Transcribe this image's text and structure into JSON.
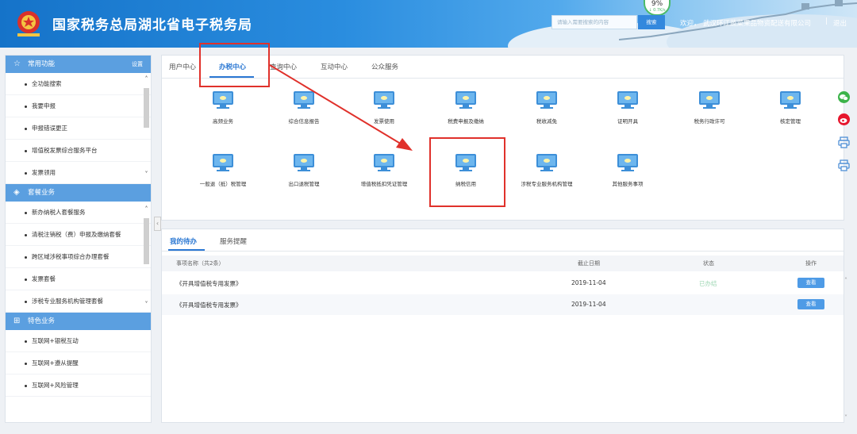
{
  "header": {
    "title": "国家税务总局湖北省电子税务局",
    "search_placeholder": "请输入需要搜索的内容",
    "search_button": "搜索",
    "speed_value": "9%",
    "speed_sub": "↓ 0.7K/s",
    "welcome": "欢迎，",
    "company": "武汉环江蔬菜果品物资配送有限公司",
    "separator": "|",
    "logout": "退出"
  },
  "sidebar": {
    "sections": [
      {
        "title": "常用功能",
        "icon": "star-icon",
        "setting": "设置",
        "items": [
          "全功能搜索",
          "我要申报",
          "申报错误更正",
          "增值税发票综合服务平台",
          "发票领用"
        ]
      },
      {
        "title": "套餐业务",
        "icon": "layers-icon",
        "items": [
          "新办纳税人套餐服务",
          "清税注销税（费）申报及缴纳套餐",
          "跨区域涉税事项综合办理套餐",
          "发票套餐",
          "涉税专业服务机构管理套餐"
        ]
      },
      {
        "title": "特色业务",
        "icon": "grid-icon",
        "items": [
          "互联网+银税互动",
          "互联网+遵从提醒",
          "互联网+风险管理"
        ]
      }
    ]
  },
  "main": {
    "tabs": [
      "用户中心",
      "办税中心",
      "查询中心",
      "互动中心",
      "公众服务"
    ],
    "active_tab": "办税中心",
    "services_row1": [
      "高频业务",
      "综合信息报告",
      "发票使用",
      "税费申报及缴纳",
      "税收减免",
      "证明开具",
      "税务行政许可",
      "核定管理"
    ],
    "services_row2": [
      "一般退（抵）税管理",
      "出口退税管理",
      "增值税抵扣凭证管理",
      "纳税信用",
      "涉税专业服务机构管理",
      "其他服务事项"
    ]
  },
  "todo": {
    "tabs": [
      "我的待办",
      "服务提醒"
    ],
    "columns": [
      "事项名称（共2条）",
      "截止日期",
      "状态",
      "操作"
    ],
    "rows": [
      {
        "name": "《开具增值税专用发票》",
        "date": "2019-11-04",
        "status": "已办结",
        "action": "查看"
      },
      {
        "name": "《开具增值税专用发票》",
        "date": "2019-11-04",
        "status": "",
        "action": "查看"
      }
    ]
  },
  "colors": {
    "header_blue": "#1573c9",
    "accent": "#2b78d3",
    "annotation_red": "#e0312b"
  },
  "floating_icons": [
    "wechat-icon",
    "weibo-icon",
    "print-icon",
    "print-icon"
  ]
}
